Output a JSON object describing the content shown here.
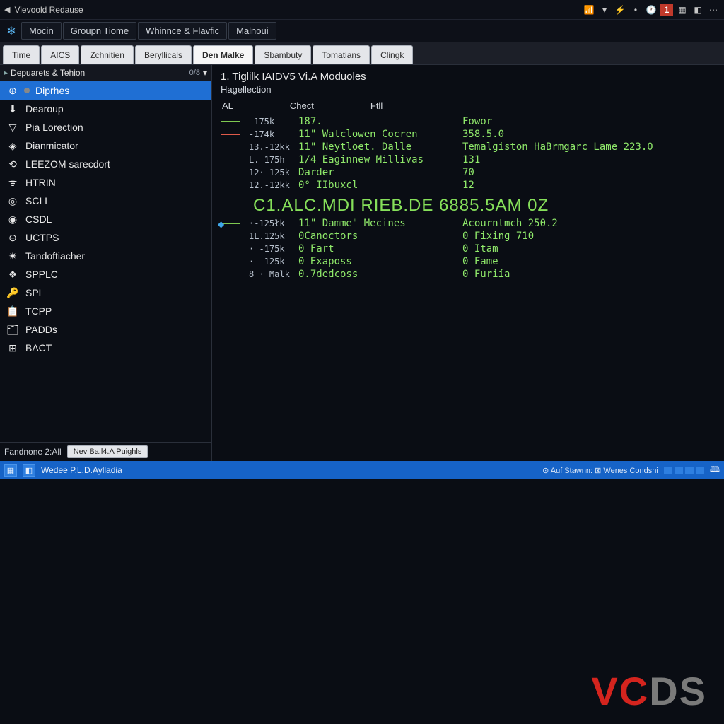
{
  "titlebar": {
    "back": "◀",
    "text": "Vievoold Redause"
  },
  "menubar": {
    "items": [
      "Mocin",
      "Groupn Tiome",
      "Whinnce & Flavfic",
      "Malnoui"
    ]
  },
  "tabs": {
    "items": [
      "Time",
      "AICS",
      "Zchnitien",
      "Beryllicals",
      "Den Malke",
      "Sbambuty",
      "Tomatians",
      "Clingk"
    ],
    "active_index": 4
  },
  "sidebar": {
    "header": {
      "arrow": "▸",
      "label": "Depuarets & Tehion",
      "badge": "0/8",
      "down": "▾"
    },
    "selected_index": 0,
    "items": [
      {
        "icon": "⊕",
        "disc": true,
        "label": "Diprhes"
      },
      {
        "icon": "⬇",
        "disc": false,
        "label": "Dearoup"
      },
      {
        "icon": "▽",
        "disc": false,
        "label": "Pia Lorection"
      },
      {
        "icon": "◈",
        "disc": false,
        "label": "Dianmicator"
      },
      {
        "icon": "⟲",
        "disc": false,
        "label": "LEEZOM sarecdort"
      },
      {
        "icon": "ᯤ",
        "disc": false,
        "label": "HTRIN"
      },
      {
        "icon": "◎",
        "disc": false,
        "label": "SCI L"
      },
      {
        "icon": "◉",
        "disc": false,
        "label": "CSDL"
      },
      {
        "icon": "⊝",
        "disc": false,
        "label": "UCTPS"
      },
      {
        "icon": "✷",
        "disc": false,
        "label": "Tandoftiacher"
      },
      {
        "icon": "❖",
        "disc": false,
        "label": "SPPLC"
      },
      {
        "icon": "🔑",
        "disc": false,
        "label": "SPL"
      },
      {
        "icon": "📋",
        "disc": false,
        "label": "TCPP"
      },
      {
        "icon": "🗂",
        "disc": false,
        "label": "PADDs"
      },
      {
        "icon": "⊞",
        "disc": false,
        "label": "BACT"
      }
    ],
    "footer": {
      "left": "Fandnone 2:All",
      "btn": "Nev Ba.l4.A Puighls"
    }
  },
  "content": {
    "heading": "1. Tiglilk IAIDV5 Vi.A Moduoles",
    "subheading": "Hagellection",
    "columns": {
      "a": "AL",
      "b": "Chect",
      "c": "Ftll"
    },
    "bigcode": "C1.ALC.MDI  RIEB.DE 6885.5AM 0Z",
    "rows_top": [
      {
        "marker": "green",
        "tick": "-175k",
        "b": "187.",
        "c": "Fowor"
      },
      {
        "marker": "red",
        "tick": "-174k",
        "b": "11\" Watclowen Cocren",
        "c": "358.5.0"
      },
      {
        "marker": "",
        "tick": "13.-12kk",
        "b": "11\" Neytloet. Dalle",
        "c": "Temalgiston HaBrmgarc Lame 223.0"
      },
      {
        "marker": "",
        "tick": "L.-175h",
        "b": "1/4 Eaginnew Millivas",
        "c": "131"
      },
      {
        "marker": "",
        "tick": "12·-125k",
        "b": "Darder",
        "c": "70"
      },
      {
        "marker": "",
        "tick": "12.-12kk",
        "b": "0° IIbuxcl",
        "c": "12"
      }
    ],
    "rows_bottom": [
      {
        "marker": "green",
        "tick": "·-125łk",
        "b": "11\" Damme\" Mecines",
        "c": "Acourntmch 250.2"
      },
      {
        "marker": "",
        "tick": "1L.125k",
        "b": "0Canoctors",
        "c": "0 Fixing 710"
      },
      {
        "marker": "",
        "tick": "· -175k",
        "b": "0 Fart",
        "c": "0 Itam"
      },
      {
        "marker": "",
        "tick": "· -125k",
        "b": "0 Exaposs",
        "c": "0 Fame"
      },
      {
        "marker": "",
        "tick": "8 · Malk",
        "b": "0.7dedcoss",
        "c": "0 Furiía"
      }
    ]
  },
  "statusbar": {
    "text": "Wedee P.L.D.Aylladia",
    "right": "⊙ Auf Stawnn:  ⊠ Wenes Condshi"
  },
  "logo": {
    "a": "VC",
    "b": "DS"
  }
}
